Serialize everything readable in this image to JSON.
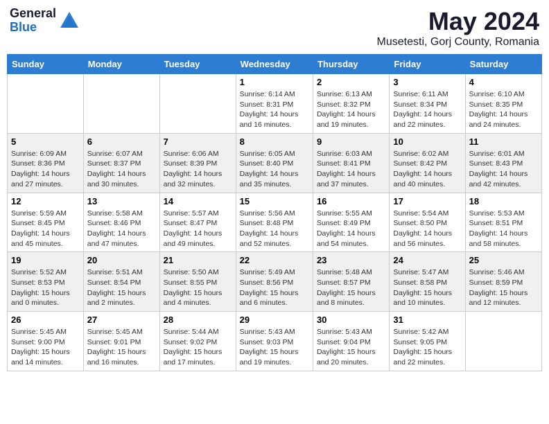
{
  "header": {
    "logo_general": "General",
    "logo_blue": "Blue",
    "title": "May 2024",
    "subtitle": "Musetesti, Gorj County, Romania"
  },
  "weekdays": [
    "Sunday",
    "Monday",
    "Tuesday",
    "Wednesday",
    "Thursday",
    "Friday",
    "Saturday"
  ],
  "weeks": [
    [
      {
        "day": "",
        "info": ""
      },
      {
        "day": "",
        "info": ""
      },
      {
        "day": "",
        "info": ""
      },
      {
        "day": "1",
        "info": "Sunrise: 6:14 AM\nSunset: 8:31 PM\nDaylight: 14 hours\nand 16 minutes."
      },
      {
        "day": "2",
        "info": "Sunrise: 6:13 AM\nSunset: 8:32 PM\nDaylight: 14 hours\nand 19 minutes."
      },
      {
        "day": "3",
        "info": "Sunrise: 6:11 AM\nSunset: 8:34 PM\nDaylight: 14 hours\nand 22 minutes."
      },
      {
        "day": "4",
        "info": "Sunrise: 6:10 AM\nSunset: 8:35 PM\nDaylight: 14 hours\nand 24 minutes."
      }
    ],
    [
      {
        "day": "5",
        "info": "Sunrise: 6:09 AM\nSunset: 8:36 PM\nDaylight: 14 hours\nand 27 minutes."
      },
      {
        "day": "6",
        "info": "Sunrise: 6:07 AM\nSunset: 8:37 PM\nDaylight: 14 hours\nand 30 minutes."
      },
      {
        "day": "7",
        "info": "Sunrise: 6:06 AM\nSunset: 8:39 PM\nDaylight: 14 hours\nand 32 minutes."
      },
      {
        "day": "8",
        "info": "Sunrise: 6:05 AM\nSunset: 8:40 PM\nDaylight: 14 hours\nand 35 minutes."
      },
      {
        "day": "9",
        "info": "Sunrise: 6:03 AM\nSunset: 8:41 PM\nDaylight: 14 hours\nand 37 minutes."
      },
      {
        "day": "10",
        "info": "Sunrise: 6:02 AM\nSunset: 8:42 PM\nDaylight: 14 hours\nand 40 minutes."
      },
      {
        "day": "11",
        "info": "Sunrise: 6:01 AM\nSunset: 8:43 PM\nDaylight: 14 hours\nand 42 minutes."
      }
    ],
    [
      {
        "day": "12",
        "info": "Sunrise: 5:59 AM\nSunset: 8:45 PM\nDaylight: 14 hours\nand 45 minutes."
      },
      {
        "day": "13",
        "info": "Sunrise: 5:58 AM\nSunset: 8:46 PM\nDaylight: 14 hours\nand 47 minutes."
      },
      {
        "day": "14",
        "info": "Sunrise: 5:57 AM\nSunset: 8:47 PM\nDaylight: 14 hours\nand 49 minutes."
      },
      {
        "day": "15",
        "info": "Sunrise: 5:56 AM\nSunset: 8:48 PM\nDaylight: 14 hours\nand 52 minutes."
      },
      {
        "day": "16",
        "info": "Sunrise: 5:55 AM\nSunset: 8:49 PM\nDaylight: 14 hours\nand 54 minutes."
      },
      {
        "day": "17",
        "info": "Sunrise: 5:54 AM\nSunset: 8:50 PM\nDaylight: 14 hours\nand 56 minutes."
      },
      {
        "day": "18",
        "info": "Sunrise: 5:53 AM\nSunset: 8:51 PM\nDaylight: 14 hours\nand 58 minutes."
      }
    ],
    [
      {
        "day": "19",
        "info": "Sunrise: 5:52 AM\nSunset: 8:53 PM\nDaylight: 15 hours\nand 0 minutes."
      },
      {
        "day": "20",
        "info": "Sunrise: 5:51 AM\nSunset: 8:54 PM\nDaylight: 15 hours\nand 2 minutes."
      },
      {
        "day": "21",
        "info": "Sunrise: 5:50 AM\nSunset: 8:55 PM\nDaylight: 15 hours\nand 4 minutes."
      },
      {
        "day": "22",
        "info": "Sunrise: 5:49 AM\nSunset: 8:56 PM\nDaylight: 15 hours\nand 6 minutes."
      },
      {
        "day": "23",
        "info": "Sunrise: 5:48 AM\nSunset: 8:57 PM\nDaylight: 15 hours\nand 8 minutes."
      },
      {
        "day": "24",
        "info": "Sunrise: 5:47 AM\nSunset: 8:58 PM\nDaylight: 15 hours\nand 10 minutes."
      },
      {
        "day": "25",
        "info": "Sunrise: 5:46 AM\nSunset: 8:59 PM\nDaylight: 15 hours\nand 12 minutes."
      }
    ],
    [
      {
        "day": "26",
        "info": "Sunrise: 5:45 AM\nSunset: 9:00 PM\nDaylight: 15 hours\nand 14 minutes."
      },
      {
        "day": "27",
        "info": "Sunrise: 5:45 AM\nSunset: 9:01 PM\nDaylight: 15 hours\nand 16 minutes."
      },
      {
        "day": "28",
        "info": "Sunrise: 5:44 AM\nSunset: 9:02 PM\nDaylight: 15 hours\nand 17 minutes."
      },
      {
        "day": "29",
        "info": "Sunrise: 5:43 AM\nSunset: 9:03 PM\nDaylight: 15 hours\nand 19 minutes."
      },
      {
        "day": "30",
        "info": "Sunrise: 5:43 AM\nSunset: 9:04 PM\nDaylight: 15 hours\nand 20 minutes."
      },
      {
        "day": "31",
        "info": "Sunrise: 5:42 AM\nSunset: 9:05 PM\nDaylight: 15 hours\nand 22 minutes."
      },
      {
        "day": "",
        "info": ""
      }
    ]
  ]
}
